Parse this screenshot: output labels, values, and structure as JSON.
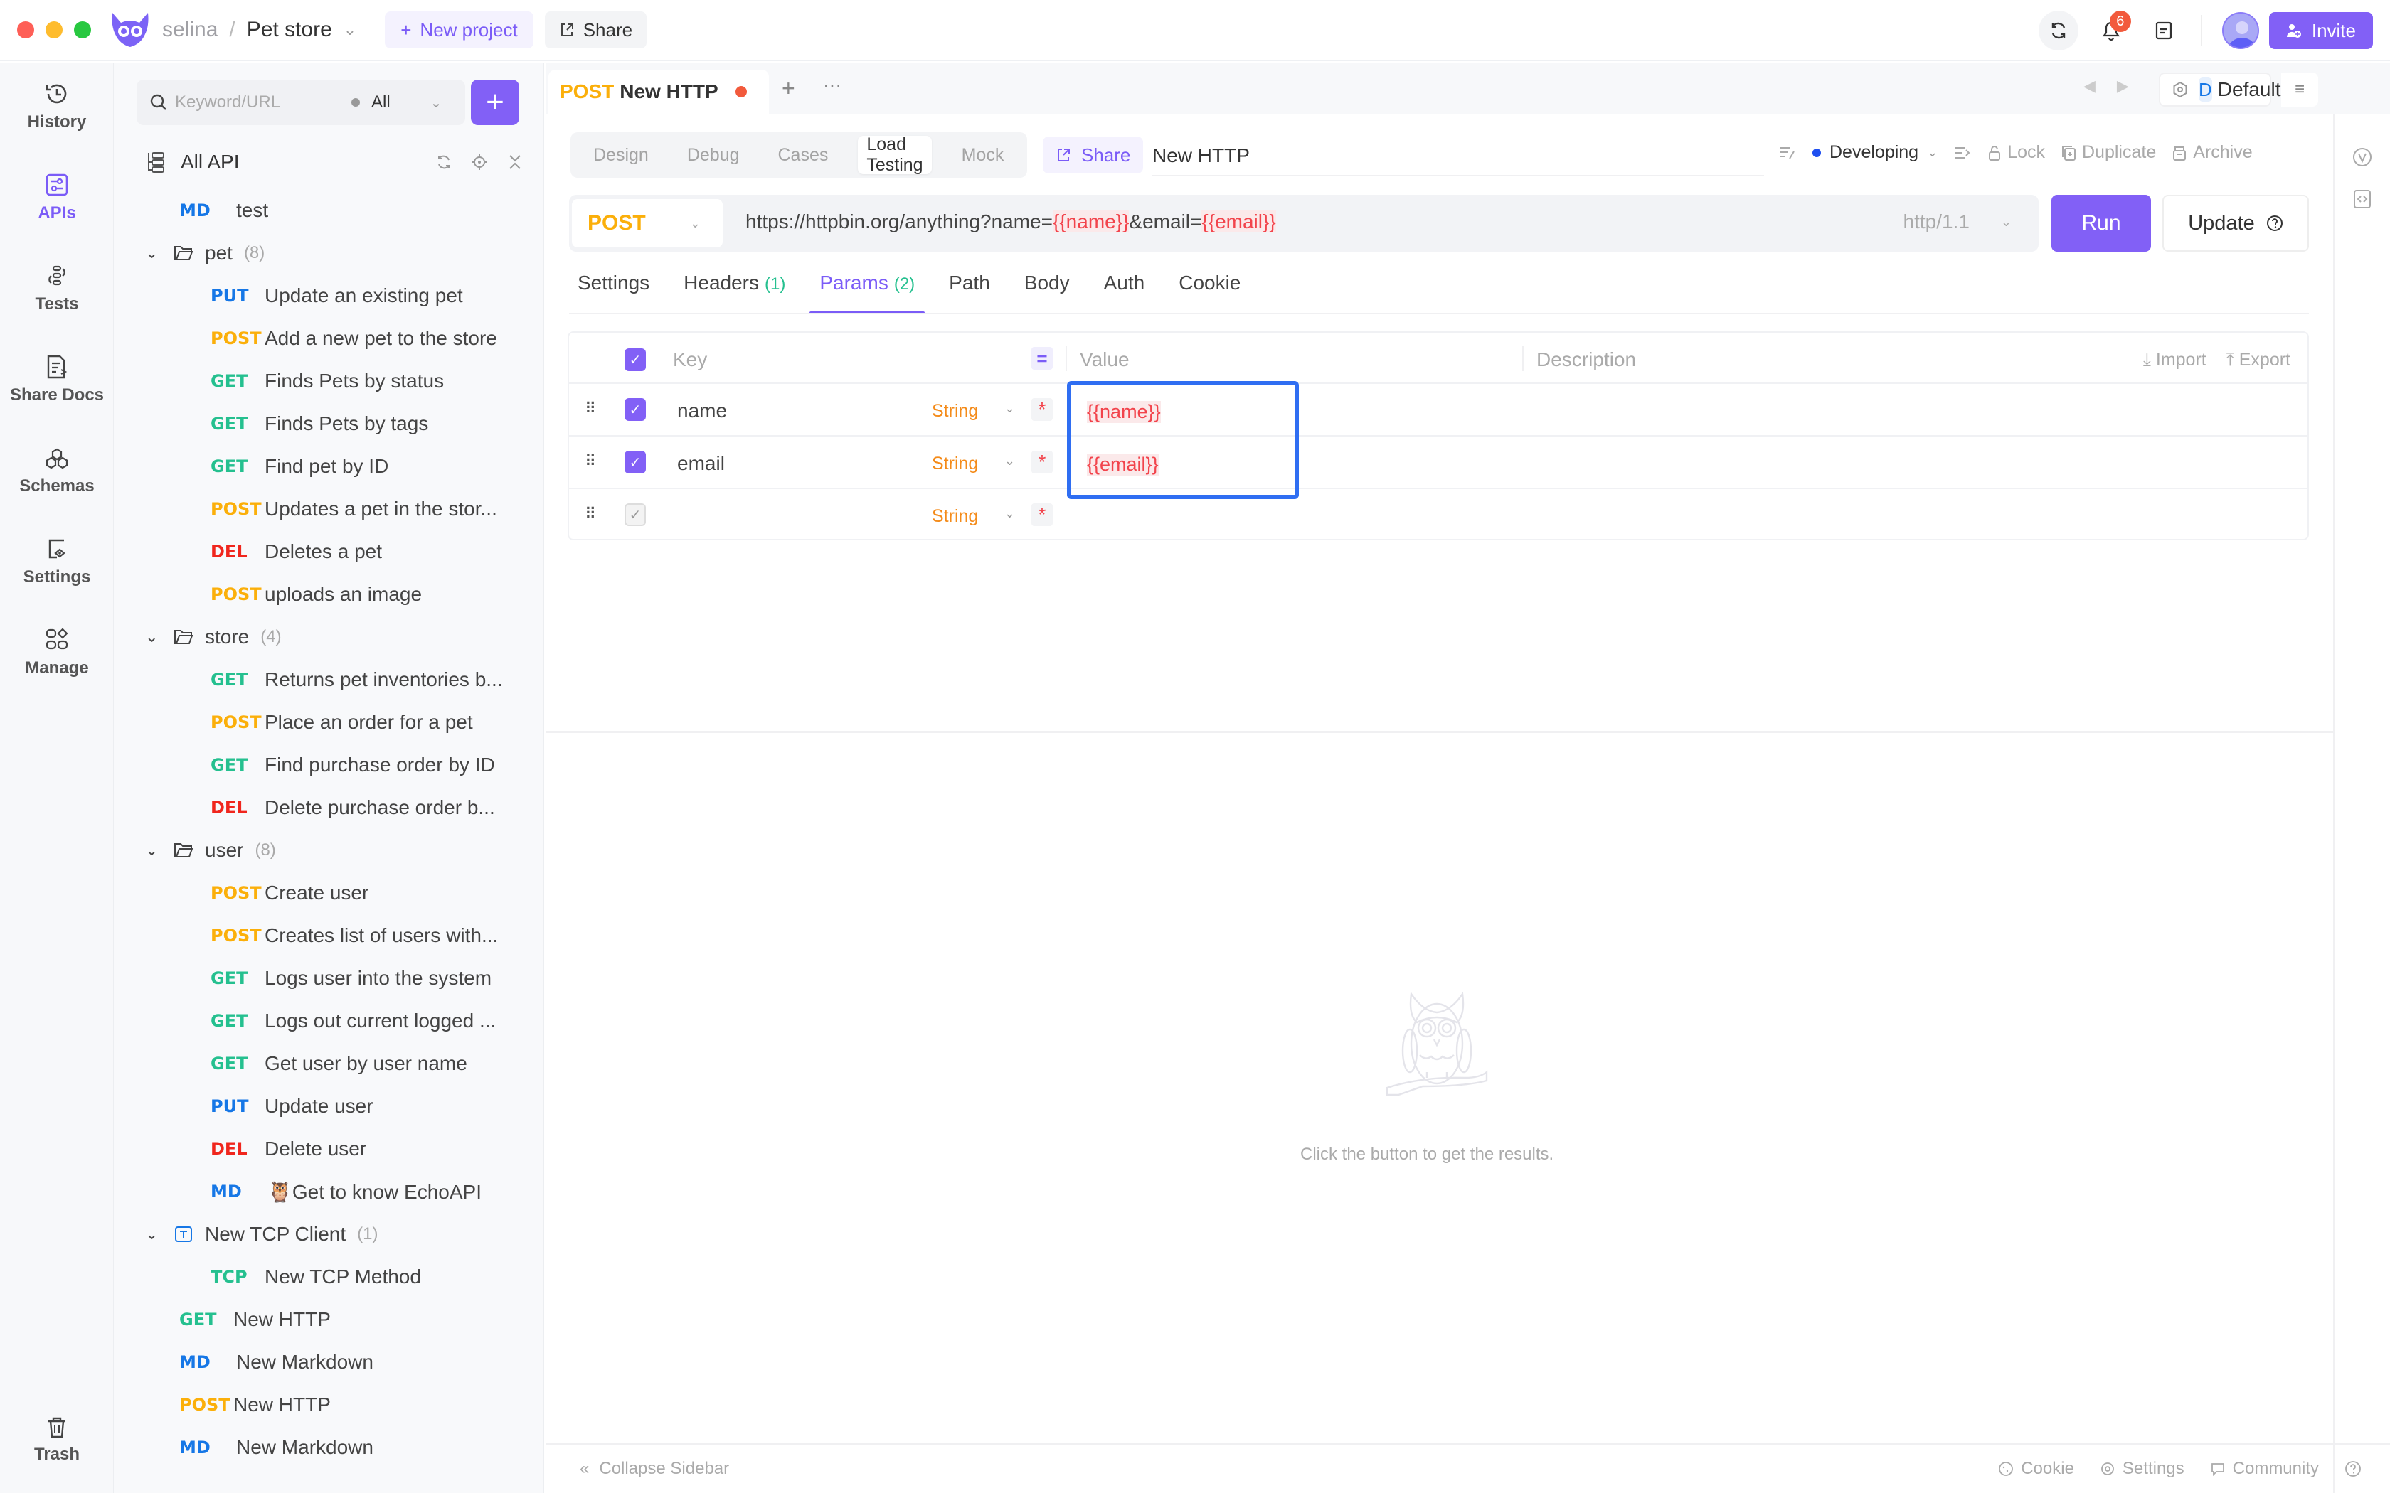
{
  "titlebar": {
    "user": "selina",
    "separator": "/",
    "project": "Pet store",
    "new_project_label": "New project",
    "share_label": "Share",
    "notification_count": "6",
    "invite_label": "Invite"
  },
  "leftnav": {
    "items": [
      {
        "label": "History",
        "icon": "history-icon"
      },
      {
        "label": "APIs",
        "icon": "apis-icon",
        "active": true
      },
      {
        "label": "Tests",
        "icon": "tests-icon"
      },
      {
        "label": "Share Docs",
        "icon": "share-docs-icon"
      },
      {
        "label": "Schemas",
        "icon": "schemas-icon"
      },
      {
        "label": "Settings",
        "icon": "settings-icon"
      },
      {
        "label": "Manage",
        "icon": "manage-icon"
      }
    ],
    "trash_label": "Trash"
  },
  "sidebar": {
    "search_placeholder": "Keyword/URL",
    "filter_value": "All",
    "all_api_label": "All API",
    "tree": [
      {
        "type": "item",
        "method": "MD",
        "name": "test",
        "level": 0
      },
      {
        "type": "folder",
        "name": "pet",
        "count": "(8)"
      },
      {
        "type": "item",
        "method": "PUT",
        "name": "Update an existing pet",
        "level": 1
      },
      {
        "type": "item",
        "method": "POST",
        "name": "Add a new pet to the store",
        "level": 1
      },
      {
        "type": "item",
        "method": "GET",
        "name": "Finds Pets by status",
        "level": 1
      },
      {
        "type": "item",
        "method": "GET",
        "name": "Finds Pets by tags",
        "level": 1
      },
      {
        "type": "item",
        "method": "GET",
        "name": "Find pet by ID",
        "level": 1
      },
      {
        "type": "item",
        "method": "POST",
        "name": "Updates a pet in the stor...",
        "level": 1
      },
      {
        "type": "item",
        "method": "DEL",
        "name": "Deletes a pet",
        "level": 1
      },
      {
        "type": "item",
        "method": "POST",
        "name": "uploads an image",
        "level": 1
      },
      {
        "type": "folder",
        "name": "store",
        "count": "(4)"
      },
      {
        "type": "item",
        "method": "GET",
        "name": "Returns pet inventories b...",
        "level": 1
      },
      {
        "type": "item",
        "method": "POST",
        "name": "Place an order for a pet",
        "level": 1
      },
      {
        "type": "item",
        "method": "GET",
        "name": "Find purchase order by ID",
        "level": 1
      },
      {
        "type": "item",
        "method": "DEL",
        "name": "Delete purchase order b...",
        "level": 1
      },
      {
        "type": "folder",
        "name": "user",
        "count": "(8)"
      },
      {
        "type": "item",
        "method": "POST",
        "name": "Create user",
        "level": 1
      },
      {
        "type": "item",
        "method": "POST",
        "name": "Creates list of users with...",
        "level": 1
      },
      {
        "type": "item",
        "method": "GET",
        "name": "Logs user into the system",
        "level": 1
      },
      {
        "type": "item",
        "method": "GET",
        "name": "Logs out current logged ...",
        "level": 1
      },
      {
        "type": "item",
        "method": "GET",
        "name": "Get user by user name",
        "level": 1
      },
      {
        "type": "item",
        "method": "PUT",
        "name": "Update user",
        "level": 1
      },
      {
        "type": "item",
        "method": "DEL",
        "name": "Delete user",
        "level": 1
      },
      {
        "type": "item",
        "method": "MD",
        "name": "🦉Get to know EchoAPI",
        "level": 1
      },
      {
        "type": "tcpfolder",
        "name": "New TCP Client",
        "count": "(1)"
      },
      {
        "type": "item",
        "method": "TCP",
        "name": "New TCP Method",
        "level": 1
      },
      {
        "type": "item",
        "method": "GET",
        "name": "New HTTP",
        "level": 0
      },
      {
        "type": "item",
        "method": "MD",
        "name": "New Markdown",
        "level": 0
      },
      {
        "type": "item",
        "method": "POST",
        "name": "New HTTP",
        "level": 0
      },
      {
        "type": "item",
        "method": "MD",
        "name": "New Markdown",
        "level": 0
      }
    ]
  },
  "tabs": {
    "open": [
      {
        "method": "POST",
        "title": "New HTTP",
        "unsaved": true
      }
    ],
    "environment": {
      "initial": "D",
      "name": "Default"
    }
  },
  "request": {
    "modes": [
      "Design",
      "Debug",
      "Cases",
      "Load Testing",
      "Mock"
    ],
    "active_mode": "Load Testing",
    "share_label": "Share",
    "name": "New HTTP",
    "status": "Developing",
    "status_color": "#1f4ff0",
    "actions": [
      "Lock",
      "Duplicate",
      "Archive"
    ],
    "method": "POST",
    "url_parts": [
      {
        "text": "https://httpbin.org/anything?name=",
        "var": false
      },
      {
        "text": "{{name}}",
        "var": true
      },
      {
        "text": "&email=",
        "var": false
      },
      {
        "text": "{{email}}",
        "var": true
      }
    ],
    "protocol": "http/1.1",
    "run_label": "Run",
    "update_label": "Update"
  },
  "request_tabs": [
    {
      "label": "Settings",
      "count": ""
    },
    {
      "label": "Headers",
      "count": "(1)"
    },
    {
      "label": "Params",
      "count": "(2)",
      "active": true
    },
    {
      "label": "Path",
      "count": ""
    },
    {
      "label": "Body",
      "count": ""
    },
    {
      "label": "Auth",
      "count": ""
    },
    {
      "label": "Cookie",
      "count": ""
    }
  ],
  "params": {
    "headers": {
      "key": "Key",
      "value": "Value",
      "description": "Description",
      "import": "Import",
      "export": "Export"
    },
    "rows": [
      {
        "enabled": true,
        "key": "name",
        "type": "String",
        "required": "*",
        "value": "{{name}}"
      },
      {
        "enabled": true,
        "key": "email",
        "type": "String",
        "required": "*",
        "value": "{{email}}"
      },
      {
        "enabled": false,
        "key": "",
        "type": "String",
        "required": "*",
        "value": ""
      }
    ]
  },
  "result": {
    "empty_message": "Click the button to get the results."
  },
  "footer": {
    "collapse_label": "Collapse Sidebar",
    "links": [
      "Cookie",
      "Settings",
      "Community"
    ]
  },
  "colors": {
    "accent": "#8260f6",
    "GET": "#25c08f",
    "POST": "#fbaf0a",
    "PUT": "#1677e6",
    "DEL": "#f0261d",
    "MD": "#1677e6",
    "TCP": "#25c08f",
    "variable": "#f2444c",
    "highlight": "#2f6ef2"
  }
}
